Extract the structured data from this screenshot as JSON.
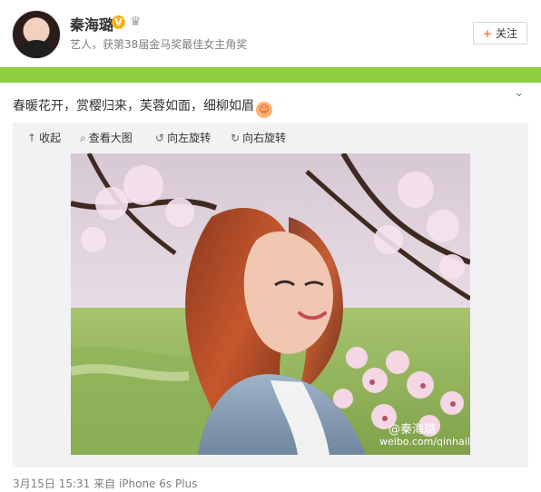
{
  "user": {
    "name": "秦海璐",
    "verified_mark": "V",
    "bio": "艺人，获第38届金马奖最佳女主角奖"
  },
  "actions": {
    "follow_label": "关注",
    "follow_icon": "plus-icon"
  },
  "post": {
    "text": "春暖花开，赏樱归来，芙蓉如面，细柳如眉",
    "emoji": "smiley-emoji",
    "toolbar": [
      {
        "icon": "collapse-icon",
        "label": "收起"
      },
      {
        "icon": "magnifier-icon",
        "label": "查看大图"
      },
      {
        "icon": "rotate-left-icon",
        "label": "向左旋转"
      },
      {
        "icon": "rotate-right-icon",
        "label": "向右旋转"
      }
    ],
    "watermark_name": "@秦海璐",
    "watermark_url": "weibo.com/qinhailu",
    "timestamp": "3月15日 15:31 来自 iPhone 6s Plus"
  },
  "colors": {
    "accent_green": "#8ecf42",
    "verified_gold": "#f6b21a",
    "follow_plus": "#ff8140"
  }
}
